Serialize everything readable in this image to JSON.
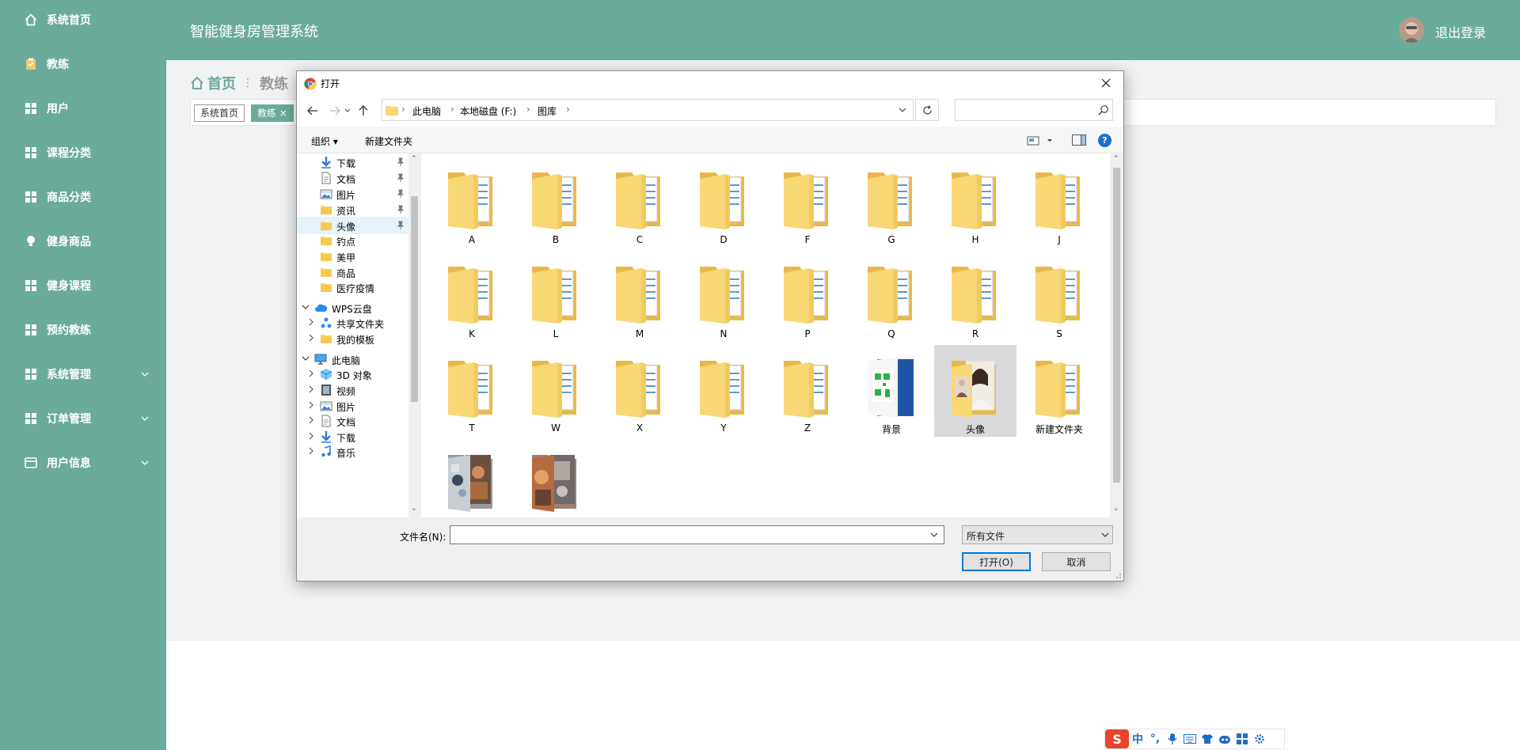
{
  "sidebar": {
    "items": [
      {
        "label": "系统首页",
        "icon": "home-icon"
      },
      {
        "label": "教练",
        "icon": "clipboard-icon"
      },
      {
        "label": "用户",
        "icon": "grid-icon"
      },
      {
        "label": "课程分类",
        "icon": "grid-icon"
      },
      {
        "label": "商品分类",
        "icon": "grid-icon"
      },
      {
        "label": "健身商品",
        "icon": "bulb-icon"
      },
      {
        "label": "健身课程",
        "icon": "grid-icon"
      },
      {
        "label": "预约教练",
        "icon": "grid-icon"
      },
      {
        "label": "系统管理",
        "icon": "grid-icon",
        "expandable": true
      },
      {
        "label": "订单管理",
        "icon": "grid-icon",
        "expandable": true
      },
      {
        "label": "用户信息",
        "icon": "card-icon",
        "expandable": true
      }
    ]
  },
  "header": {
    "title": "智能健身房管理系统",
    "logout": "退出登录"
  },
  "breadcrumb": {
    "home": "首页",
    "current": "教练"
  },
  "page_tabs": [
    {
      "label": "系统首页"
    },
    {
      "label": "教练 ×",
      "active": true
    }
  ],
  "dialog": {
    "title": "打开",
    "address": {
      "crumbs": [
        "此电脑",
        "本地磁盘 (F:)",
        "图库"
      ]
    },
    "search_placeholder": "",
    "commands": {
      "organize": "组织 ▾",
      "new_folder": "新建文件夹",
      "help": "?"
    },
    "nav": [
      {
        "label": "下载",
        "icon": "download-icon",
        "pinned": true
      },
      {
        "label": "文档",
        "icon": "document-icon",
        "pinned": true
      },
      {
        "label": "图片",
        "icon": "picture-icon",
        "pinned": true
      },
      {
        "label": "资讯",
        "icon": "folder-icon",
        "pinned": true
      },
      {
        "label": "头像",
        "icon": "folder-icon",
        "pinned": true,
        "hover": true
      },
      {
        "label": "钓点",
        "icon": "folder-icon"
      },
      {
        "label": "美甲",
        "icon": "folder-icon"
      },
      {
        "label": "商品",
        "icon": "folder-icon"
      },
      {
        "label": "医疗疫情",
        "icon": "folder-icon"
      },
      {
        "label": "WPS云盘",
        "icon": "cloud-icon",
        "expanded": true,
        "level": 0
      },
      {
        "label": "共享文件夹",
        "icon": "share-icon",
        "collapsed": true
      },
      {
        "label": "我的模板",
        "icon": "folder-icon",
        "collapsed": true
      },
      {
        "label": "此电脑",
        "icon": "computer-icon",
        "expanded": true,
        "level": 0
      },
      {
        "label": "3D 对象",
        "icon": "cube-icon",
        "collapsed": true
      },
      {
        "label": "视频",
        "icon": "video-icon",
        "collapsed": true
      },
      {
        "label": "图片",
        "icon": "picture-icon",
        "collapsed": true
      },
      {
        "label": "文档",
        "icon": "document-icon",
        "collapsed": true
      },
      {
        "label": "下载",
        "icon": "download-icon",
        "collapsed": true
      },
      {
        "label": "音乐",
        "icon": "music-icon",
        "collapsed": true
      }
    ],
    "files": [
      {
        "name": "A"
      },
      {
        "name": "B"
      },
      {
        "name": "C"
      },
      {
        "name": "D"
      },
      {
        "name": "F"
      },
      {
        "name": "G"
      },
      {
        "name": "H"
      },
      {
        "name": "J"
      },
      {
        "name": "K"
      },
      {
        "name": "L"
      },
      {
        "name": "M"
      },
      {
        "name": "N"
      },
      {
        "name": "P"
      },
      {
        "name": "Q"
      },
      {
        "name": "R"
      },
      {
        "name": "S"
      },
      {
        "name": "T"
      },
      {
        "name": "W"
      },
      {
        "name": "X"
      },
      {
        "name": "Y"
      },
      {
        "name": "Z"
      },
      {
        "name": "背景",
        "thumb": "qr"
      },
      {
        "name": "头像",
        "thumb": "portrait",
        "selected": true
      },
      {
        "name": "新建文件夹"
      },
      {
        "name": "",
        "thumb": "photo1"
      },
      {
        "name": "",
        "thumb": "photo2"
      }
    ],
    "filename_label": "文件名(N):",
    "filename_value": "",
    "filetype": "所有文件",
    "open_button": "打开(O)",
    "cancel_button": "取消"
  },
  "ime": {
    "logo": "S",
    "mode": "中",
    "punct": "°,"
  },
  "colors": {
    "brand": "#6aab9c",
    "folder": "#f8d775",
    "selected": "#d9d9d9"
  }
}
